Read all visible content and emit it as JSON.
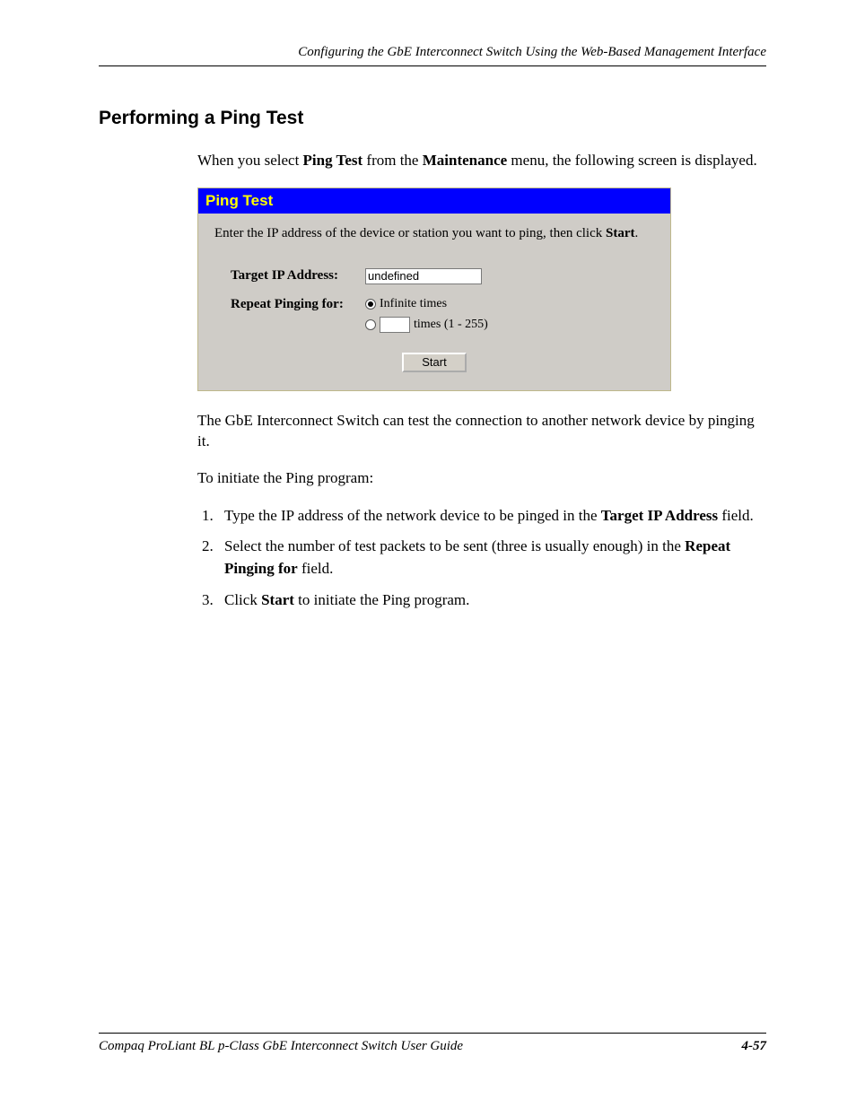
{
  "header": {
    "running_title": "Configuring the GbE Interconnect Switch Using the Web-Based Management Interface"
  },
  "section": {
    "title": "Performing a Ping Test",
    "intro_pre": "When you select ",
    "intro_bold1": "Ping Test",
    "intro_mid": " from the ",
    "intro_bold2": "Maintenance",
    "intro_post": " menu, the following screen is displayed."
  },
  "screenshot": {
    "panel_title": "Ping Test",
    "instruction_pre": "Enter the IP address of the device or station you want to ping, then click ",
    "instruction_bold": "Start",
    "instruction_post": ".",
    "label_target": "Target IP Address:",
    "target_value": "undefined",
    "label_repeat": "Repeat Pinging for:",
    "radio_infinite": "Infinite times",
    "radio_times_value": "",
    "radio_times_suffix": "times (1 - 255)",
    "start_button": "Start"
  },
  "after_text_1": "The GbE Interconnect Switch can test the connection to another network device by pinging it.",
  "after_text_2": "To initiate the Ping program:",
  "steps": {
    "s1_pre": "Type the IP address of the network device to be pinged in the ",
    "s1_bold": "Target IP Address",
    "s1_post": " field.",
    "s2_pre": "Select the number of test packets to be sent (three is usually enough) in the ",
    "s2_bold": "Repeat Pinging for",
    "s2_post": " field.",
    "s3_pre": "Click ",
    "s3_bold": "Start",
    "s3_post": " to initiate the Ping program."
  },
  "footer": {
    "doc_title": "Compaq ProLiant BL p-Class GbE Interconnect Switch User Guide",
    "page_number": "4-57"
  }
}
